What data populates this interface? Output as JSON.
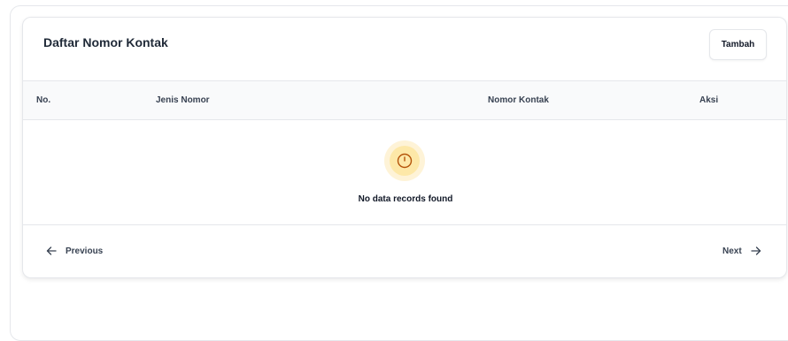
{
  "card": {
    "title": "Daftar Nomor Kontak",
    "add_button_label": "Tambah"
  },
  "table": {
    "columns": [
      "No.",
      "Jenis Nomor",
      "Nomor Kontak",
      "Aksi"
    ],
    "rows": [],
    "empty_message": "No data records found"
  },
  "pagination": {
    "previous_label": "Previous",
    "next_label": "Next"
  },
  "icons": {
    "empty_state": "clock-icon",
    "previous": "arrow-left-icon",
    "next": "arrow-right-icon"
  },
  "colors": {
    "empty_ring_outer": "#fef3d7",
    "empty_ring_inner": "#fde8a8",
    "empty_icon_stroke": "#b45309"
  }
}
